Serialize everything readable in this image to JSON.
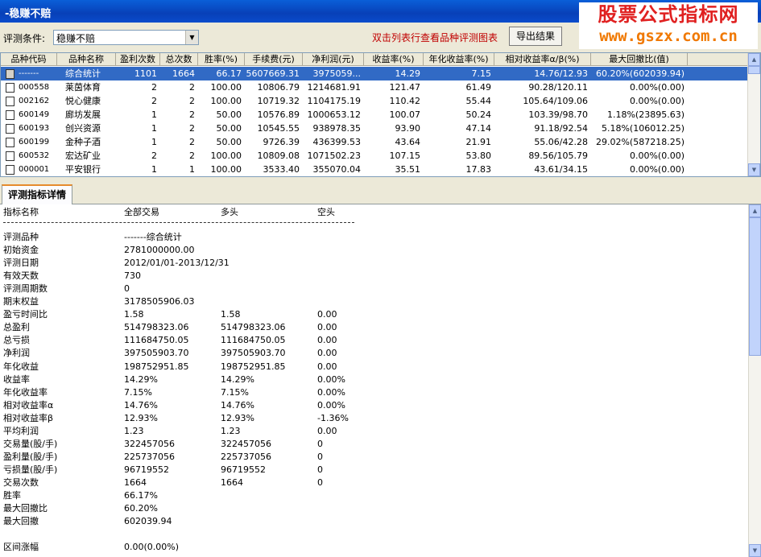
{
  "window": {
    "title": "-稳赚不赔"
  },
  "watermark": {
    "line1": "股票公式指标网",
    "line2": "www.gszx.com.cn"
  },
  "filter": {
    "label": "评测条件:",
    "selected": "稳赚不赔",
    "hint": "双击列表行查看品种评测图表",
    "export_label": "导出结果"
  },
  "table": {
    "columns": [
      "品种代码",
      "品种名称",
      "盈利次数",
      "总次数",
      "胜率(%)",
      "手续费(元)",
      "净利润(元)",
      "收益率(%)",
      "年化收益率(%)",
      "相对收益率α/β(%)",
      "最大回撤比(值)"
    ],
    "rows": [
      [
        "-------",
        "综合统计",
        "1101",
        "1664",
        "66.17",
        "5607669.31",
        "3975059...",
        "14.29",
        "7.15",
        "14.76/12.93",
        "60.20%(602039.94)"
      ],
      [
        "000558",
        "莱茵体育",
        "2",
        "2",
        "100.00",
        "10806.79",
        "1214681.91",
        "121.47",
        "61.49",
        "90.28/120.11",
        "0.00%(0.00)"
      ],
      [
        "002162",
        "悦心健康",
        "2",
        "2",
        "100.00",
        "10719.32",
        "1104175.19",
        "110.42",
        "55.44",
        "105.64/109.06",
        "0.00%(0.00)"
      ],
      [
        "600149",
        "廊坊发展",
        "1",
        "2",
        "50.00",
        "10576.89",
        "1000653.12",
        "100.07",
        "50.24",
        "103.39/98.70",
        "1.18%(23895.63)"
      ],
      [
        "600193",
        "创兴资源",
        "1",
        "2",
        "50.00",
        "10545.55",
        "938978.35",
        "93.90",
        "47.14",
        "91.18/92.54",
        "5.18%(106012.25)"
      ],
      [
        "600199",
        "金种子酒",
        "1",
        "2",
        "50.00",
        "9726.39",
        "436399.53",
        "43.64",
        "21.91",
        "55.06/42.28",
        "29.02%(587218.25)"
      ],
      [
        "600532",
        "宏达矿业",
        "2",
        "2",
        "100.00",
        "10809.08",
        "1071502.23",
        "107.15",
        "53.80",
        "89.56/105.79",
        "0.00%(0.00)"
      ],
      [
        "000001",
        "平安银行",
        "1",
        "1",
        "100.00",
        "3533.40",
        "355070.04",
        "35.51",
        "17.83",
        "43.61/34.15",
        "0.00%(0.00)"
      ]
    ]
  },
  "tab": {
    "label": "评测指标详情"
  },
  "detail": {
    "header": [
      "指标名称",
      "全部交易",
      "多头",
      "空头"
    ],
    "rows": [
      [
        "评测品种",
        "-------综合统计",
        "",
        ""
      ],
      [
        "初始资金",
        "2781000000.00",
        "",
        ""
      ],
      [
        "评测日期",
        "2012/01/01-2013/12/31",
        "",
        ""
      ],
      [
        "有效天数",
        "730",
        "",
        ""
      ],
      [
        "评测周期数",
        "0",
        "",
        ""
      ],
      [
        "期末权益",
        "3178505906.03",
        "",
        ""
      ],
      [
        "盈亏时间比",
        "1.58",
        "1.58",
        "0.00"
      ],
      [
        "总盈利",
        "514798323.06",
        "514798323.06",
        "0.00"
      ],
      [
        "总亏损",
        "111684750.05",
        "111684750.05",
        "0.00"
      ],
      [
        "净利润",
        "397505903.70",
        "397505903.70",
        "0.00"
      ],
      [
        "年化收益",
        "198752951.85",
        "198752951.85",
        "0.00"
      ],
      [
        "收益率",
        "14.29%",
        "14.29%",
        "0.00%"
      ],
      [
        "年化收益率",
        "7.15%",
        "7.15%",
        "0.00%"
      ],
      [
        "相对收益率α",
        "14.76%",
        " 14.76%",
        " 0.00%"
      ],
      [
        "相对收益率β",
        "12.93%",
        " 12.93%",
        " -1.36%"
      ],
      [
        "平均利润",
        "1.23",
        "1.23",
        "0.00"
      ],
      [
        "交易量(股/手)",
        "322457056",
        "322457056",
        "0"
      ],
      [
        "盈利量(股/手)",
        "225737056",
        "225737056",
        "0"
      ],
      [
        "亏损量(股/手)",
        "96719552",
        "96719552",
        "0"
      ],
      [
        "交易次数",
        "1664",
        "1664",
        "0"
      ],
      [
        "胜率",
        "66.17%",
        "",
        ""
      ],
      [
        "最大回撤比",
        "60.20%",
        "",
        ""
      ],
      [
        "最大回撤",
        "602039.94",
        "",
        ""
      ],
      [
        "",
        "",
        "",
        ""
      ],
      [
        "区间涨幅",
        "0.00(0.00%)",
        "",
        ""
      ]
    ]
  }
}
